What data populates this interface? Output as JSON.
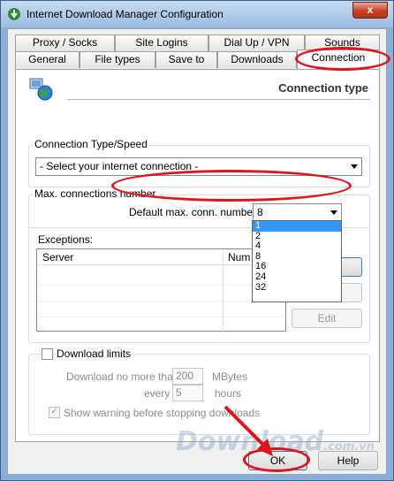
{
  "window": {
    "title": "Internet Download Manager Configuration",
    "close_label": "x"
  },
  "tabs_row1": [
    {
      "label": "Proxy / Socks"
    },
    {
      "label": "Site Logins"
    },
    {
      "label": "Dial Up / VPN"
    },
    {
      "label": "Sounds"
    }
  ],
  "tabs_row2": [
    {
      "label": "General"
    },
    {
      "label": "File types"
    },
    {
      "label": "Save to"
    },
    {
      "label": "Downloads"
    },
    {
      "label": "Connection",
      "active": true
    }
  ],
  "page": {
    "header": "Connection type",
    "connection_group_label": "Connection Type/Speed",
    "connection_select_value": "- Select your internet connection -",
    "max_conn_group_label": "Max. connections number",
    "default_max_label": "Default max. conn. number",
    "default_max_value": "8",
    "dropdown_options": [
      "1",
      "2",
      "4",
      "8",
      "16",
      "24",
      "32"
    ],
    "dropdown_selected": "1",
    "exceptions_label": "Exceptions:",
    "exceptions_columns": [
      "Server",
      "Num"
    ],
    "edit_button": "Edit",
    "download_limits_label": "Download limits",
    "download_no_more_label": "Download no more than",
    "download_no_more_value": "200",
    "mbytes_label": "MBytes",
    "every_label": "every",
    "every_value": "5",
    "hours_label": "hours",
    "show_warning_label": "Show warning before stopping downloads"
  },
  "buttons": {
    "ok": "OK",
    "help": "Help"
  },
  "watermark": {
    "text": "Download",
    "suffix": ".com.vn"
  },
  "colors": {
    "highlight_ring": "#e0141b",
    "selection_blue": "#3399ff"
  }
}
